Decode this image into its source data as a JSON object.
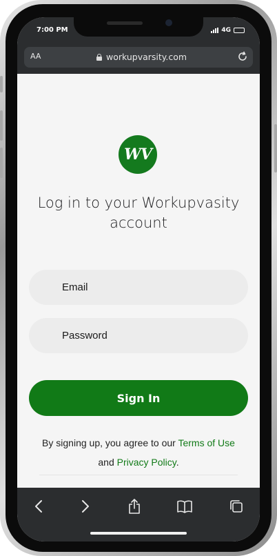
{
  "status_bar": {
    "time": "7:00 PM",
    "network": "4G"
  },
  "browser": {
    "text_size_label": "AA",
    "url": "workupvarsity.com"
  },
  "logo": {
    "text": "WV"
  },
  "login": {
    "heading_line1": "Log in to your Workupvasity",
    "heading_line2": "account",
    "email_placeholder": "Email",
    "password_placeholder": "Password",
    "sign_in_label": "Sign In",
    "agree_prefix": "By signing up, you agree to our ",
    "terms_link": "Terms of Use",
    "and_text": "and ",
    "privacy_link": "Privacy Policy",
    "period": "."
  },
  "colors": {
    "brand_green": "#117a17",
    "toolbar_dark": "#2b2d2f",
    "field_bg": "#ececec"
  },
  "toolbar": {
    "icons": [
      "back-icon",
      "forward-icon",
      "share-icon",
      "bookmarks-icon",
      "tabs-icon"
    ]
  }
}
